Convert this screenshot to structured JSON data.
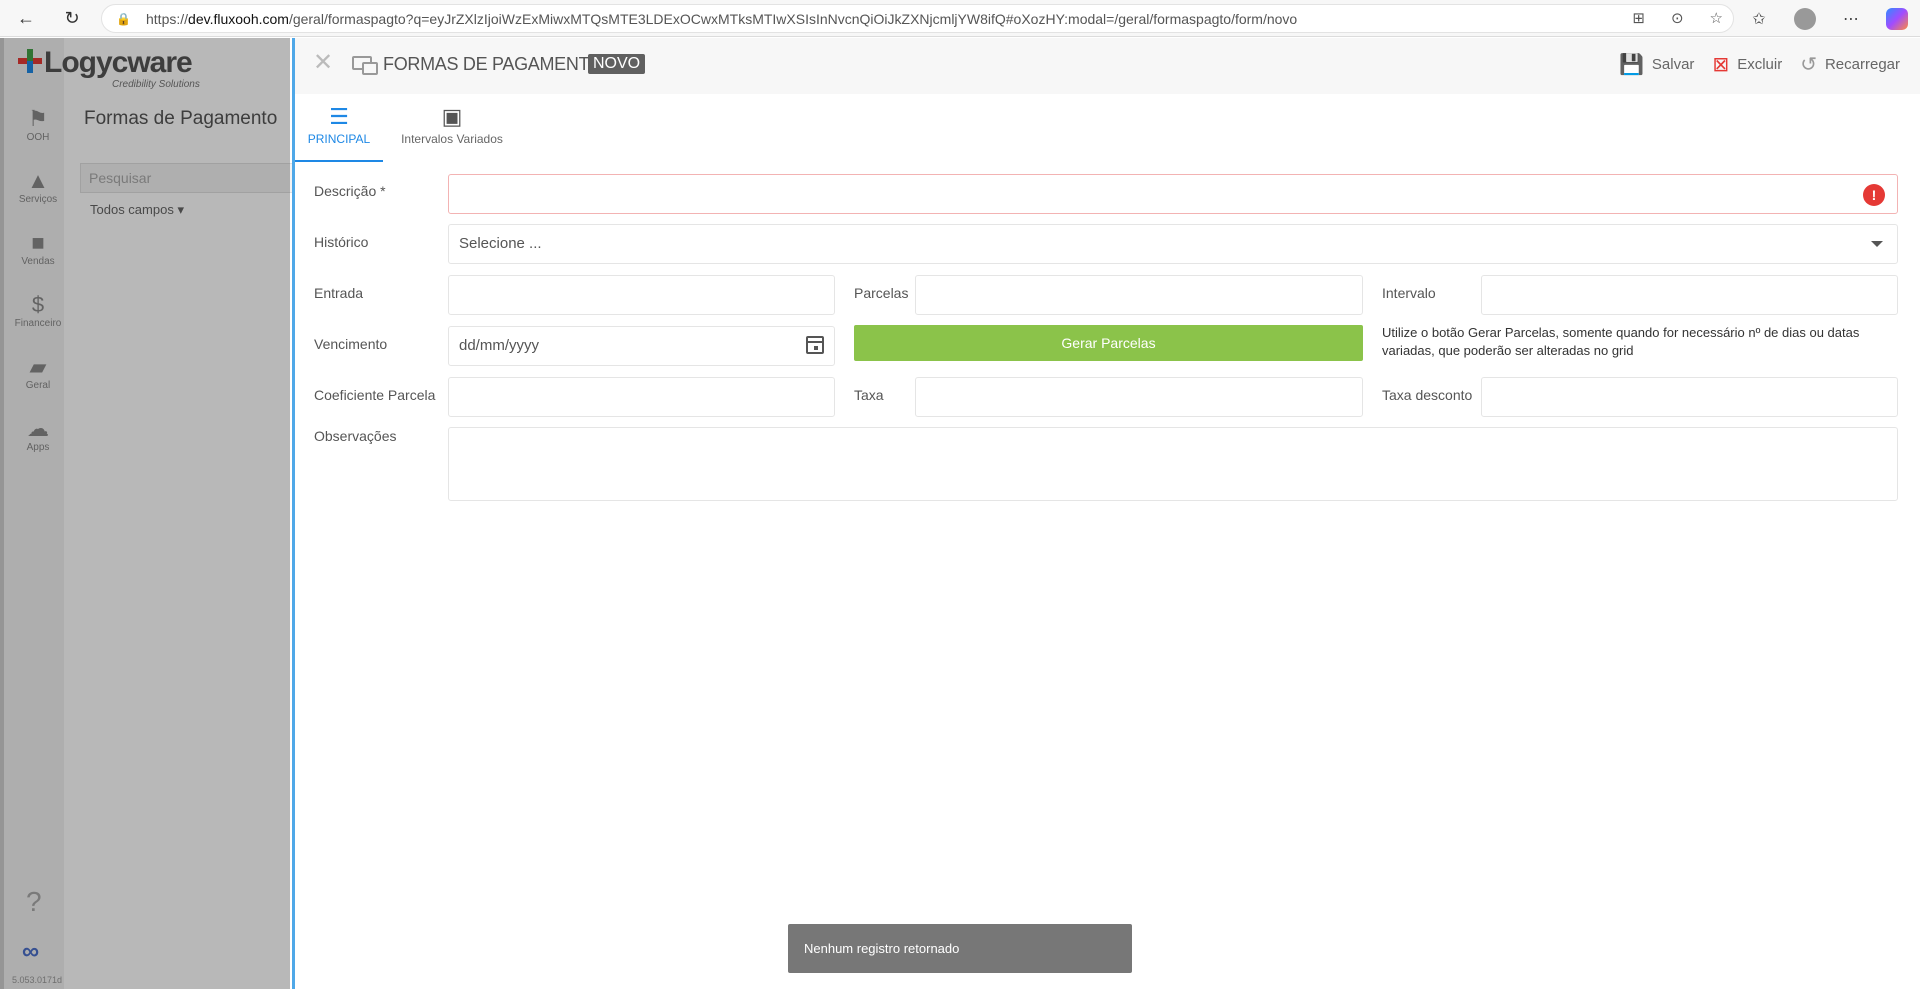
{
  "browser": {
    "url_prefix": "https://",
    "url_domain": "dev.fluxooh.com",
    "url_rest": "/geral/formaspagto?q=eyJrZXlzIjoiWzExMiwxMTQsMTE3LDExOCwxMTksMTIwXSIsInNvcnQiOiJkZXNjcmljYW8ifQ#oXozHY:modal=/geral/formaspagto/form/novo"
  },
  "app": {
    "logo_text": "Logycware",
    "logo_sub": "Credibility Solutions",
    "sidebar": [
      {
        "label": "OOH",
        "icon": "flag-icon"
      },
      {
        "label": "Serviços",
        "icon": "services-icon"
      },
      {
        "label": "Vendas",
        "icon": "briefcase-icon"
      },
      {
        "label": "Financeiro",
        "icon": "dollar-icon"
      },
      {
        "label": "Geral",
        "icon": "folder-icon"
      },
      {
        "label": "Apps",
        "icon": "cloud-icon"
      }
    ],
    "page_title": "Formas de Pagamento",
    "search_placeholder": "Pesquisar",
    "all_fields": "Todos campos",
    "version": "5.053.0171d"
  },
  "modal": {
    "title": "FORMAS DE PAGAMENTO",
    "badge": "NOVO",
    "actions": {
      "save": "Salvar",
      "delete": "Excluir",
      "reload": "Recarregar"
    },
    "tabs": [
      {
        "label": "PRINCIPAL",
        "active": true
      },
      {
        "label": "Intervalos Variados",
        "active": false
      }
    ],
    "form": {
      "descricao_label": "Descrição *",
      "historico_label": "Histórico",
      "historico_value": "Selecione ...",
      "entrada_label": "Entrada",
      "parcelas_label": "Parcelas",
      "intervalo_label": "Intervalo",
      "vencimento_label": "Vencimento",
      "vencimento_placeholder": "dd/mm/yyyy",
      "gerar_button": "Gerar Parcelas",
      "hint_line1": "Utilize o botão Gerar Parcelas, somente quando for necessário nº de dias ou datas",
      "hint_line2": "variadas, que poderão ser alteradas no grid",
      "coef_label": "Coeficiente Parcela",
      "taxa_label": "Taxa",
      "taxa_desc_label": "Taxa desconto",
      "obs_label": "Observações"
    }
  },
  "toast": "Nenhum registro retornado"
}
